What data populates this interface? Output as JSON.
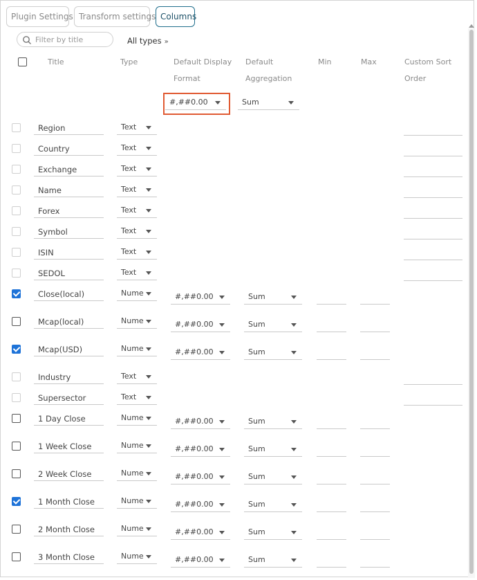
{
  "tabs": [
    {
      "label": "Plugin Settings",
      "active": false
    },
    {
      "label": "Transform settings",
      "active": false
    },
    {
      "label": "Columns",
      "active": true
    }
  ],
  "filter": {
    "placeholder": "Filter by title",
    "type_filter": "All types"
  },
  "headers": {
    "title": "Title",
    "type": "Type",
    "format_1": "Default Display",
    "format_2": "Format",
    "agg_1": "Default",
    "agg_2": "Aggregation",
    "min": "Min",
    "max": "Max",
    "sort_1": "Custom Sort",
    "sort_2": "Order"
  },
  "defaults": {
    "format": "#,##0.00",
    "aggregation": "Sum"
  },
  "colors": {
    "accent": "#1f6e8c",
    "check": "#1e73d8",
    "highlight": "#e05a32"
  },
  "rows": [
    {
      "title": "Region",
      "type": "Text",
      "checked": false,
      "numeric": false
    },
    {
      "title": "Country",
      "type": "Text",
      "checked": false,
      "numeric": false
    },
    {
      "title": "Exchange",
      "type": "Text",
      "checked": false,
      "numeric": false
    },
    {
      "title": "Name",
      "type": "Text",
      "checked": false,
      "numeric": false
    },
    {
      "title": "Forex",
      "type": "Text",
      "checked": false,
      "numeric": false
    },
    {
      "title": "Symbol",
      "type": "Text",
      "checked": false,
      "numeric": false
    },
    {
      "title": "ISIN",
      "type": "Text",
      "checked": false,
      "numeric": false
    },
    {
      "title": "SEDOL",
      "type": "Text",
      "checked": false,
      "numeric": false
    },
    {
      "title": "Close(local)",
      "type": "Nume",
      "checked": true,
      "numeric": true,
      "format": "#,##0.00",
      "aggregation": "Sum"
    },
    {
      "title": "Mcap(local)",
      "type": "Nume",
      "checked": false,
      "numeric": true,
      "format": "#,##0.00",
      "aggregation": "Sum"
    },
    {
      "title": "Mcap(USD)",
      "type": "Nume",
      "checked": true,
      "numeric": true,
      "format": "#,##0.00",
      "aggregation": "Sum"
    },
    {
      "title": "Industry",
      "type": "Text",
      "checked": false,
      "numeric": false
    },
    {
      "title": "Supersector",
      "type": "Text",
      "checked": false,
      "numeric": false
    },
    {
      "title": "1 Day Close",
      "type": "Nume",
      "checked": false,
      "numeric": true,
      "format": "#,##0.00",
      "aggregation": "Sum"
    },
    {
      "title": "1 Week Close",
      "type": "Nume",
      "checked": false,
      "numeric": true,
      "format": "#,##0.00",
      "aggregation": "Sum"
    },
    {
      "title": "2 Week Close",
      "type": "Nume",
      "checked": false,
      "numeric": true,
      "format": "#,##0.00",
      "aggregation": "Sum"
    },
    {
      "title": "1 Month Close",
      "type": "Nume",
      "checked": true,
      "numeric": true,
      "format": "#,##0.00",
      "aggregation": "Sum"
    },
    {
      "title": "2 Month Close",
      "type": "Nume",
      "checked": false,
      "numeric": true,
      "format": "#,##0.00",
      "aggregation": "Sum"
    },
    {
      "title": "3 Month Close",
      "type": "Nume",
      "checked": false,
      "numeric": true,
      "format": "#,##0.00",
      "aggregation": "Sum"
    }
  ]
}
